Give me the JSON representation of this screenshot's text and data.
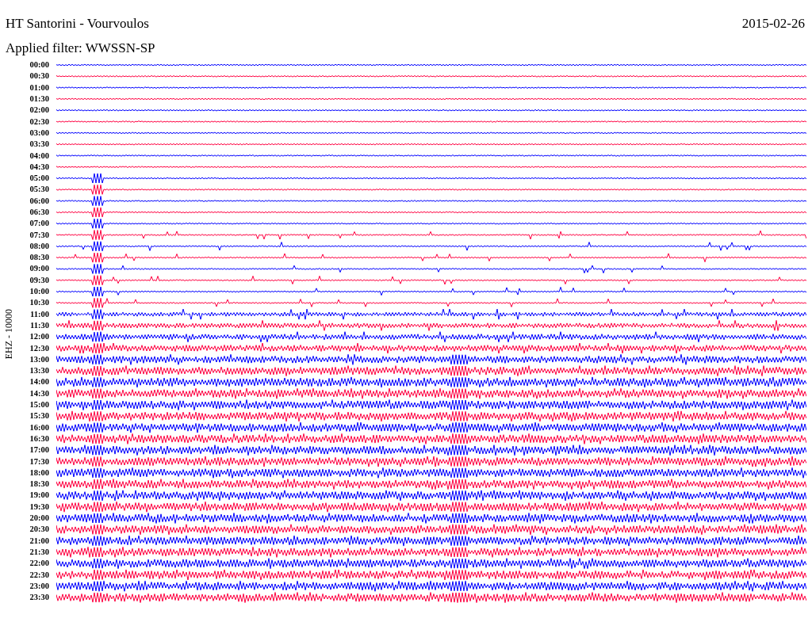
{
  "header": {
    "station": "HT Santorini - Vourvoulos",
    "date": "2015-02-26",
    "filter": "Applied filter: WWSSN-SP"
  },
  "axis_label": "EHZ - 10000",
  "rows": [
    {
      "time": "00:00",
      "color": "#0000ff"
    },
    {
      "time": "00:30",
      "color": "#ff0040"
    },
    {
      "time": "01:00",
      "color": "#0000ff"
    },
    {
      "time": "01:30",
      "color": "#ff0040"
    },
    {
      "time": "02:00",
      "color": "#0000ff"
    },
    {
      "time": "02:30",
      "color": "#ff0040"
    },
    {
      "time": "03:00",
      "color": "#0000ff"
    },
    {
      "time": "03:30",
      "color": "#ff0040"
    },
    {
      "time": "04:00",
      "color": "#0000ff"
    },
    {
      "time": "04:30",
      "color": "#ff0040"
    },
    {
      "time": "05:00",
      "color": "#0000ff"
    },
    {
      "time": "05:30",
      "color": "#ff0040"
    },
    {
      "time": "06:00",
      "color": "#0000ff"
    },
    {
      "time": "06:30",
      "color": "#ff0040"
    },
    {
      "time": "07:00",
      "color": "#0000ff"
    },
    {
      "time": "07:30",
      "color": "#ff0040"
    },
    {
      "time": "08:00",
      "color": "#0000ff"
    },
    {
      "time": "08:30",
      "color": "#ff0040"
    },
    {
      "time": "09:00",
      "color": "#0000ff"
    },
    {
      "time": "09:30",
      "color": "#ff0040"
    },
    {
      "time": "10:00",
      "color": "#0000ff"
    },
    {
      "time": "10:30",
      "color": "#ff0040"
    },
    {
      "time": "11:00",
      "color": "#0000ff"
    },
    {
      "time": "11:30",
      "color": "#ff0040"
    },
    {
      "time": "12:00",
      "color": "#0000ff"
    },
    {
      "time": "12:30",
      "color": "#ff0040"
    },
    {
      "time": "13:00",
      "color": "#0000ff"
    },
    {
      "time": "13:30",
      "color": "#ff0040"
    },
    {
      "time": "14:00",
      "color": "#0000ff"
    },
    {
      "time": "14:30",
      "color": "#ff0040"
    },
    {
      "time": "15:00",
      "color": "#0000ff"
    },
    {
      "time": "15:30",
      "color": "#ff0040"
    },
    {
      "time": "16:00",
      "color": "#0000ff"
    },
    {
      "time": "16:30",
      "color": "#ff0040"
    },
    {
      "time": "17:00",
      "color": "#0000ff"
    },
    {
      "time": "17:30",
      "color": "#ff0040"
    },
    {
      "time": "18:00",
      "color": "#0000ff"
    },
    {
      "time": "18:30",
      "color": "#ff0040"
    },
    {
      "time": "19:00",
      "color": "#0000ff"
    },
    {
      "time": "19:30",
      "color": "#ff0040"
    },
    {
      "time": "20:00",
      "color": "#0000ff"
    },
    {
      "time": "20:30",
      "color": "#ff0040"
    },
    {
      "time": "21:00",
      "color": "#0000ff"
    },
    {
      "time": "21:30",
      "color": "#ff0040"
    },
    {
      "time": "22:00",
      "color": "#0000ff"
    },
    {
      "time": "22:30",
      "color": "#ff0040"
    },
    {
      "time": "23:00",
      "color": "#0000ff"
    },
    {
      "time": "23:30",
      "color": "#ff0040"
    }
  ]
}
